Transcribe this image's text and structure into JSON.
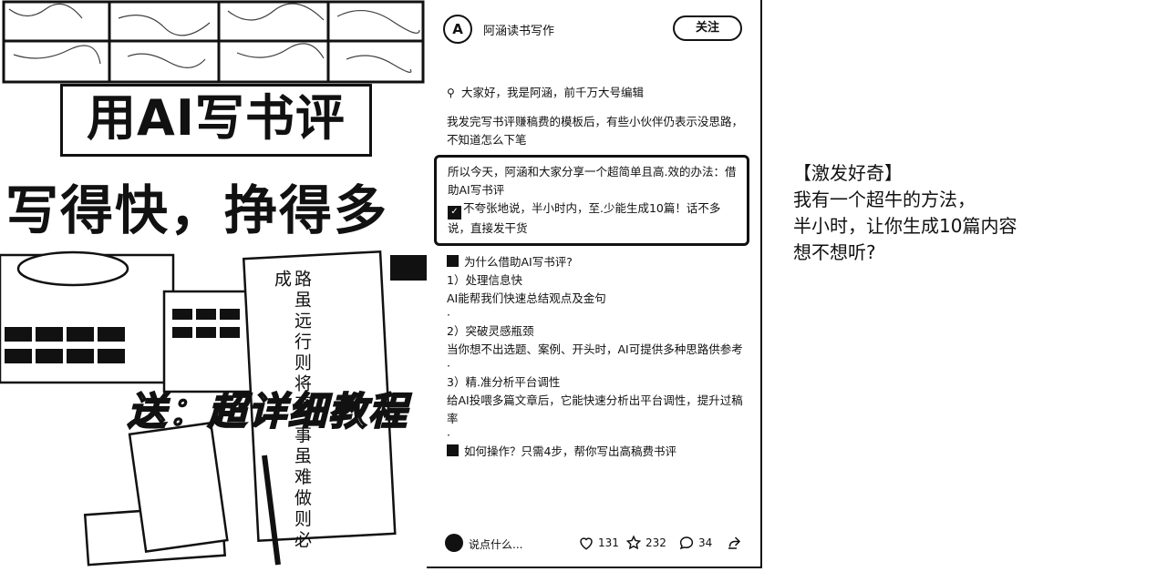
{
  "image": {
    "title": "用AI写书评",
    "subtitle": "写得快，挣得多",
    "gift_text": "送：超详细教程",
    "book_text": "路虽远行则将至 事虽难做则必成"
  },
  "post": {
    "author": "阿涵读书写作",
    "avatar_letter": "A",
    "follow_label": "关注",
    "intro": "大家好，我是阿涵，前千万大号编辑",
    "para1": "我发完写书评赚稿费的模板后，有些小伙伴仍表示没思路，不知道怎么下笔",
    "highlight1": "所以今天，阿涵和大家分享一个超简单且高.效的办法：借助AI写书评",
    "highlight2": "不夸张地说，半小时内，至.少能生成10篇！话不多说，直接发干货",
    "why_title": "为什么借助AI写书评?",
    "point1_title": "1）处理信息快",
    "point1_text": "AI能帮我们快速总结观点及金句",
    "dot": "·",
    "point2_title": "2）突破灵感瓶颈",
    "point2_text": "当你想不出选题、案例、开头时，AI可提供多种思路供参考",
    "point3_title": "3）精.准分析平台调性",
    "point3_text": "给AI投喂多篇文章后，它能快速分析出平台调性，提升过稿率",
    "cut_line": "如何操作？只需4步，帮你写出高稿费书评"
  },
  "footer": {
    "comment_placeholder": "说点什么...",
    "likes": "131",
    "stars": "232",
    "comments": "34"
  },
  "annotation": {
    "line1": "【激发好奇】",
    "line2": "我有一个超牛的方法，",
    "line3": "半小时，让你生成10篇内容",
    "line4": "想不想听?"
  },
  "icons": [
    "pin-icon",
    "check-icon",
    "lightbulb-icon",
    "heart-icon",
    "star-icon",
    "comment-icon",
    "share-icon"
  ]
}
